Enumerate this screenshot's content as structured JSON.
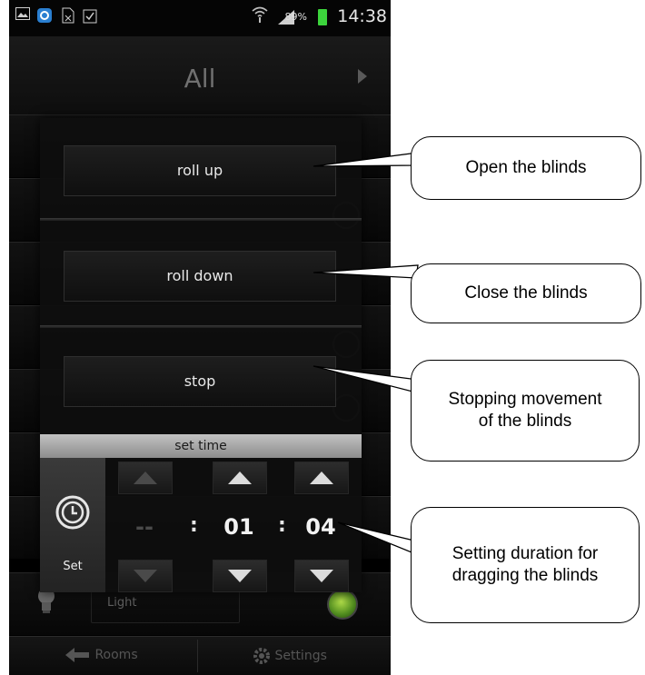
{
  "status_bar": {
    "time": "14:38",
    "battery_percent": "89%",
    "icons": [
      "gallery-icon",
      "app-icon",
      "document-icon",
      "clipboard-icon",
      "wifi-icon",
      "signal-icon",
      "battery-icon"
    ]
  },
  "header": {
    "title": "All"
  },
  "dialog": {
    "buttons": {
      "roll_up": "roll up",
      "roll_down": "roll down",
      "stop": "stop"
    },
    "set_time": {
      "title": "set time",
      "set_label": "Set",
      "hours": "--",
      "separator": ":",
      "minutes": "01",
      "seconds": "04"
    }
  },
  "background_list": {
    "light_label": "Light"
  },
  "bottom_nav": {
    "rooms": "Rooms",
    "settings": "Settings"
  },
  "annotations": {
    "open": "Open the blinds",
    "close": "Close the blinds",
    "stop": "Stopping movement of the blinds",
    "duration": "Setting duration for dragging the blinds"
  },
  "colors": {
    "accent_green": "#3cd43c",
    "dialog_bg": "#0e0e0e",
    "set_time_bar": "#a8a8a8"
  }
}
